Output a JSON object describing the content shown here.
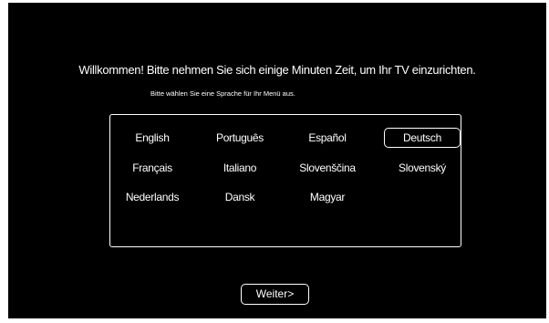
{
  "setup": {
    "welcome_text": "Willkommen! Bitte nehmen Sie sich einige Minuten Zeit, um Ihr TV einzurichten.",
    "subtitle": "Bitte wählen Sie eine Sprache für Ihr Menü aus.",
    "languages": [
      {
        "label": "English"
      },
      {
        "label": "Português"
      },
      {
        "label": "Español"
      },
      {
        "label": "Deutsch",
        "selected": true
      },
      {
        "label": "Français"
      },
      {
        "label": "Italiano"
      },
      {
        "label": "Slovenščina"
      },
      {
        "label": "Slovenský"
      },
      {
        "label": "Nederlands"
      },
      {
        "label": "Dansk"
      },
      {
        "label": "Magyar"
      }
    ],
    "next_label": "Weiter>"
  },
  "colors": {
    "screen_background": "#000000",
    "text": "#ffffff",
    "frame": "#ffffff"
  }
}
